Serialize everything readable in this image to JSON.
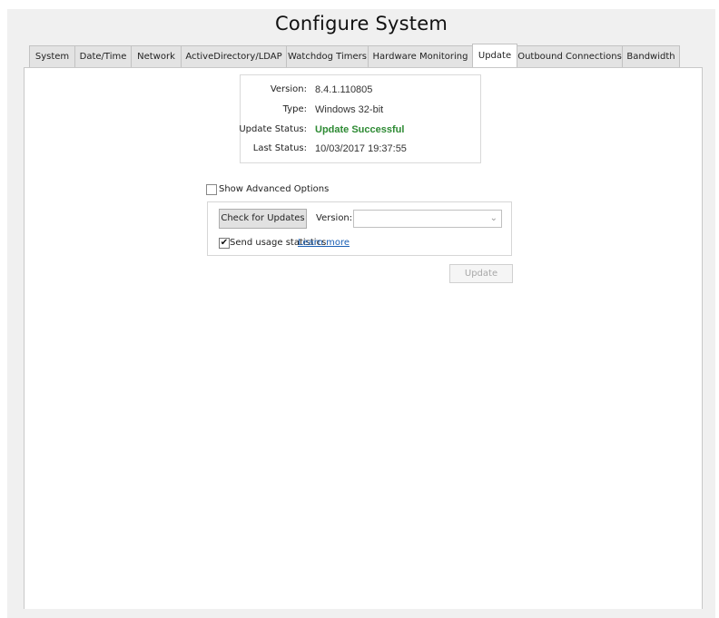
{
  "window": {
    "title": "Configure System"
  },
  "tabs": [
    {
      "label": "System"
    },
    {
      "label": "Date/Time"
    },
    {
      "label": "Network"
    },
    {
      "label": "ActiveDirectory/LDAP"
    },
    {
      "label": "Watchdog Timers"
    },
    {
      "label": "Hardware Monitoring"
    },
    {
      "label": "Update"
    },
    {
      "label": "Outbound Connections"
    },
    {
      "label": "Bandwidth"
    }
  ],
  "active_tab": "Update",
  "info": {
    "version_label": "Version:",
    "version_value": "8.4.1.110805",
    "type_label": "Type:",
    "type_value": "Windows 32-bit",
    "status_label": "Update Status:",
    "status_value": "Update Successful",
    "last_label": "Last Status:",
    "last_value": "10/03/2017 19:37:55"
  },
  "advanced": {
    "label": "Show Advanced Options",
    "checked": false
  },
  "update_box": {
    "check_button": "Check for Updates",
    "version_label": "Version:",
    "version_selected": "",
    "usage_label": "Send usage statistics",
    "usage_checked": true,
    "learn_more": "Learn more"
  },
  "update_button": {
    "label": "Update",
    "enabled": false
  },
  "colors": {
    "status_success": "#2d8a33",
    "link": "#1a5fb4"
  }
}
